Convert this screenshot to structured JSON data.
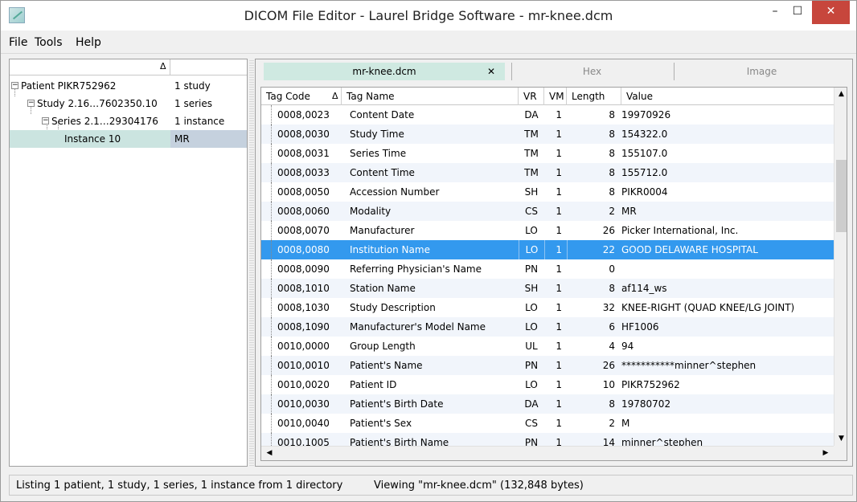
{
  "window": {
    "title": "DICOM File Editor - Laurel Bridge Software - mr-knee.dcm",
    "minimize_glyph": "–",
    "maximize_glyph": "☐",
    "close_glyph": "✕"
  },
  "menu": {
    "file": "File",
    "tools": "Tools",
    "help": "Help"
  },
  "tree": {
    "header_sort": "Δ",
    "rows": [
      {
        "name": "Patient PIKR752962",
        "info": "1 study",
        "toggle": "−"
      },
      {
        "name": "Study 2.16…7602350.10",
        "info": "1 series",
        "toggle": "−"
      },
      {
        "name": "Series 2.1…29304176",
        "info": "1 instance",
        "toggle": "−"
      },
      {
        "name": "Instance 10",
        "info": "MR"
      }
    ]
  },
  "tabs": {
    "file": "mr-knee.dcm",
    "file_close": "✕",
    "hex": "Hex",
    "image": "Image"
  },
  "grid": {
    "headers": {
      "tag": "Tag Code",
      "sort": "Δ",
      "name": "Tag Name",
      "vr": "VR",
      "vm": "VM",
      "length": "Length",
      "value": "Value"
    },
    "rows": [
      {
        "tag": "0008,0023",
        "name": "Content Date",
        "vr": "DA",
        "vm": "1",
        "length": "8",
        "value": "19970926"
      },
      {
        "tag": "0008,0030",
        "name": "Study Time",
        "vr": "TM",
        "vm": "1",
        "length": "8",
        "value": "154322.0"
      },
      {
        "tag": "0008,0031",
        "name": "Series Time",
        "vr": "TM",
        "vm": "1",
        "length": "8",
        "value": "155107.0"
      },
      {
        "tag": "0008,0033",
        "name": "Content Time",
        "vr": "TM",
        "vm": "1",
        "length": "8",
        "value": "155712.0"
      },
      {
        "tag": "0008,0050",
        "name": "Accession Number",
        "vr": "SH",
        "vm": "1",
        "length": "8",
        "value": "PIKR0004"
      },
      {
        "tag": "0008,0060",
        "name": "Modality",
        "vr": "CS",
        "vm": "1",
        "length": "2",
        "value": "MR"
      },
      {
        "tag": "0008,0070",
        "name": "Manufacturer",
        "vr": "LO",
        "vm": "1",
        "length": "26",
        "value": "Picker International, Inc."
      },
      {
        "tag": "0008,0080",
        "name": "Institution Name",
        "vr": "LO",
        "vm": "1",
        "length": "22",
        "value": "GOOD DELAWARE HOSPITAL",
        "selected": true
      },
      {
        "tag": "0008,0090",
        "name": "Referring Physician's Name",
        "vr": "PN",
        "vm": "1",
        "length": "0",
        "value": ""
      },
      {
        "tag": "0008,1010",
        "name": "Station Name",
        "vr": "SH",
        "vm": "1",
        "length": "8",
        "value": "af114_ws"
      },
      {
        "tag": "0008,1030",
        "name": "Study Description",
        "vr": "LO",
        "vm": "1",
        "length": "32",
        "value": "KNEE-RIGHT (QUAD KNEE/LG JOINT)"
      },
      {
        "tag": "0008,1090",
        "name": "Manufacturer's Model Name",
        "vr": "LO",
        "vm": "1",
        "length": "6",
        "value": "HF1006"
      },
      {
        "tag": "0010,0000",
        "name": "Group Length",
        "vr": "UL",
        "vm": "1",
        "length": "4",
        "value": "94"
      },
      {
        "tag": "0010,0010",
        "name": "Patient's Name",
        "vr": "PN",
        "vm": "1",
        "length": "26",
        "value": "***********minner^stephen"
      },
      {
        "tag": "0010,0020",
        "name": "Patient ID",
        "vr": "LO",
        "vm": "1",
        "length": "10",
        "value": "PIKR752962"
      },
      {
        "tag": "0010,0030",
        "name": "Patient's Birth Date",
        "vr": "DA",
        "vm": "1",
        "length": "8",
        "value": "19780702"
      },
      {
        "tag": "0010,0040",
        "name": "Patient's Sex",
        "vr": "CS",
        "vm": "1",
        "length": "2",
        "value": "M"
      },
      {
        "tag": "0010,1005",
        "name": "Patient's Birth Name",
        "vr": "PN",
        "vm": "1",
        "length": "14",
        "value": "minner^stephen"
      }
    ]
  },
  "status": {
    "left": "Listing 1 patient, 1 study, 1 series, 1 instance from 1 directory",
    "right": "Viewing \"mr-knee.dcm\" (132,848 bytes)"
  },
  "colors": {
    "selected_row": "#3399ee",
    "tab_active": "#cfe9e1",
    "tree_selected": "#cbe4e0",
    "close_button": "#c7463c"
  }
}
